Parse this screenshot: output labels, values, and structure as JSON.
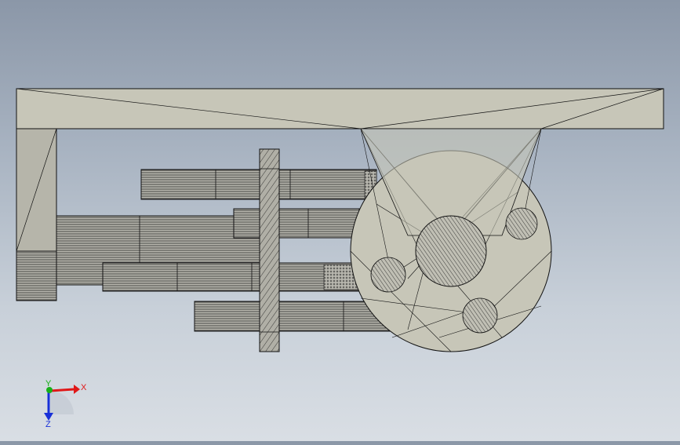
{
  "viewport": {
    "background_top": "#8b97a8",
    "background_bottom": "#d9dee4",
    "part_color": "#c7c6b8",
    "edge_color": "#111111",
    "shaft_color": "#a8a7a0"
  },
  "triad": {
    "x_label": "X",
    "y_label": "Y",
    "z_label": "Z",
    "x_color": "#e01818",
    "y_color": "#18b018",
    "z_color": "#1830d8"
  }
}
